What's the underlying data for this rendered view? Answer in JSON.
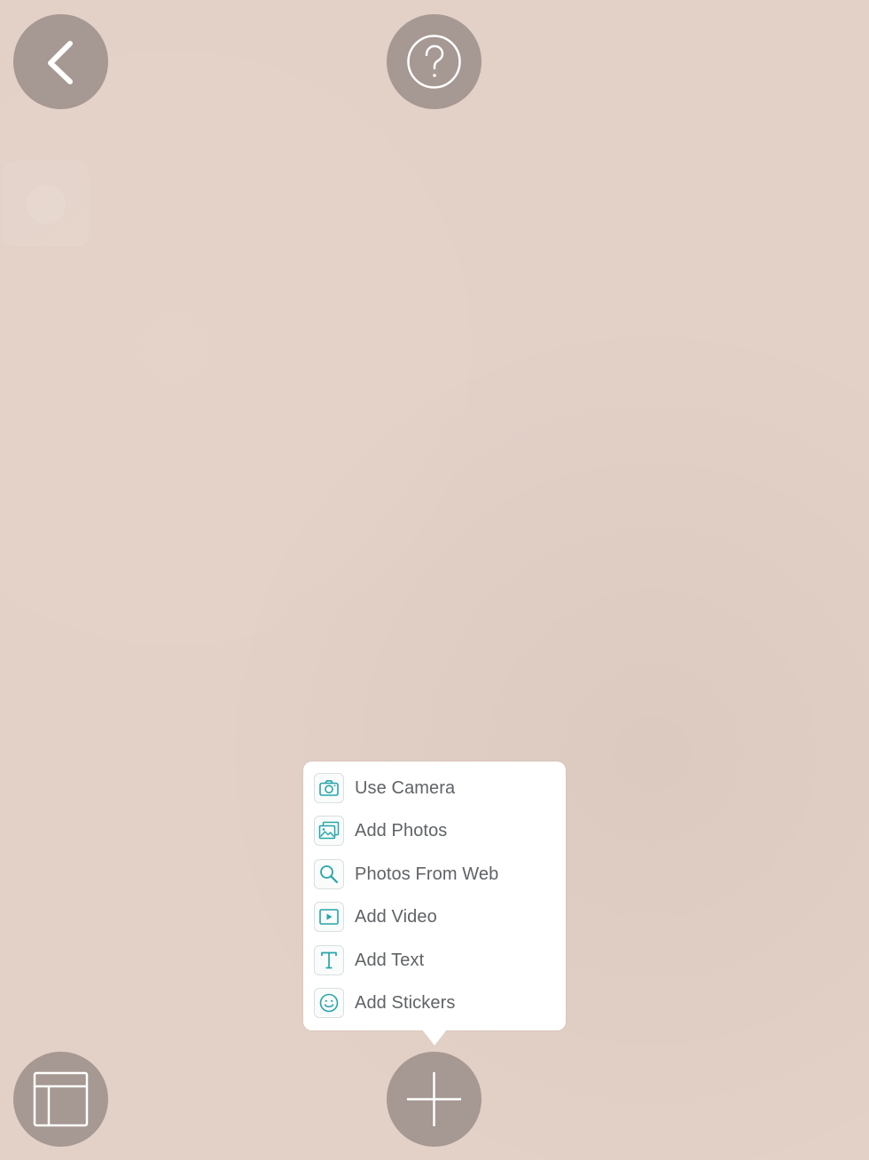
{
  "toolbar": {
    "back_icon": "chevron-left-icon",
    "help_icon": "question-circle-icon",
    "layout_icon": "layout-icon",
    "add_icon": "plus-icon"
  },
  "add_menu": {
    "items": [
      {
        "label": "Use Camera",
        "icon": "camera-icon"
      },
      {
        "label": "Add Photos",
        "icon": "photos-icon"
      },
      {
        "label": "Photos From Web",
        "icon": "search-icon"
      },
      {
        "label": "Add Video",
        "icon": "video-icon"
      },
      {
        "label": "Add Text",
        "icon": "text-icon"
      },
      {
        "label": "Add Stickers",
        "icon": "smiley-icon"
      }
    ]
  },
  "colors": {
    "background": "#e3d0c6",
    "round_button": "#a69892",
    "accent": "#26a6a8",
    "menu_text": "#5f6366"
  }
}
